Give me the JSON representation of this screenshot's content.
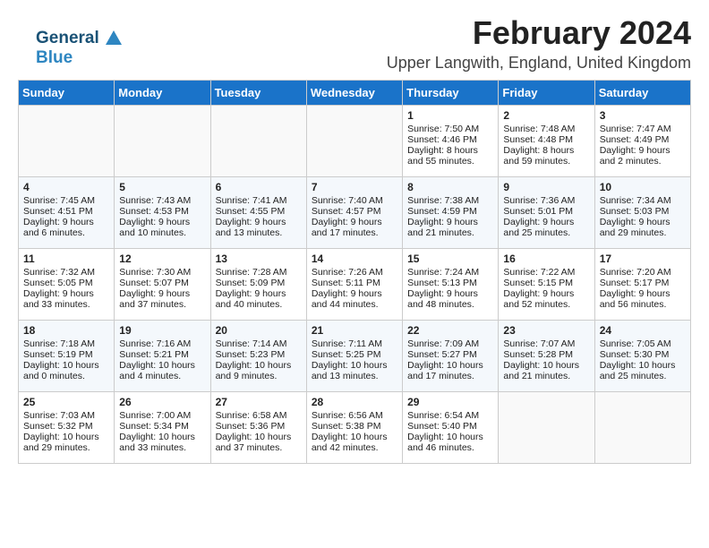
{
  "logo": {
    "line1": "General",
    "line2": "Blue"
  },
  "header": {
    "title": "February 2024",
    "subtitle": "Upper Langwith, England, United Kingdom"
  },
  "days_of_week": [
    "Sunday",
    "Monday",
    "Tuesday",
    "Wednesday",
    "Thursday",
    "Friday",
    "Saturday"
  ],
  "weeks": [
    [
      {
        "day": "",
        "sunrise": "",
        "sunset": "",
        "daylight": ""
      },
      {
        "day": "",
        "sunrise": "",
        "sunset": "",
        "daylight": ""
      },
      {
        "day": "",
        "sunrise": "",
        "sunset": "",
        "daylight": ""
      },
      {
        "day": "",
        "sunrise": "",
        "sunset": "",
        "daylight": ""
      },
      {
        "day": "1",
        "sunrise": "Sunrise: 7:50 AM",
        "sunset": "Sunset: 4:46 PM",
        "daylight": "Daylight: 8 hours and 55 minutes."
      },
      {
        "day": "2",
        "sunrise": "Sunrise: 7:48 AM",
        "sunset": "Sunset: 4:48 PM",
        "daylight": "Daylight: 8 hours and 59 minutes."
      },
      {
        "day": "3",
        "sunrise": "Sunrise: 7:47 AM",
        "sunset": "Sunset: 4:49 PM",
        "daylight": "Daylight: 9 hours and 2 minutes."
      }
    ],
    [
      {
        "day": "4",
        "sunrise": "Sunrise: 7:45 AM",
        "sunset": "Sunset: 4:51 PM",
        "daylight": "Daylight: 9 hours and 6 minutes."
      },
      {
        "day": "5",
        "sunrise": "Sunrise: 7:43 AM",
        "sunset": "Sunset: 4:53 PM",
        "daylight": "Daylight: 9 hours and 10 minutes."
      },
      {
        "day": "6",
        "sunrise": "Sunrise: 7:41 AM",
        "sunset": "Sunset: 4:55 PM",
        "daylight": "Daylight: 9 hours and 13 minutes."
      },
      {
        "day": "7",
        "sunrise": "Sunrise: 7:40 AM",
        "sunset": "Sunset: 4:57 PM",
        "daylight": "Daylight: 9 hours and 17 minutes."
      },
      {
        "day": "8",
        "sunrise": "Sunrise: 7:38 AM",
        "sunset": "Sunset: 4:59 PM",
        "daylight": "Daylight: 9 hours and 21 minutes."
      },
      {
        "day": "9",
        "sunrise": "Sunrise: 7:36 AM",
        "sunset": "Sunset: 5:01 PM",
        "daylight": "Daylight: 9 hours and 25 minutes."
      },
      {
        "day": "10",
        "sunrise": "Sunrise: 7:34 AM",
        "sunset": "Sunset: 5:03 PM",
        "daylight": "Daylight: 9 hours and 29 minutes."
      }
    ],
    [
      {
        "day": "11",
        "sunrise": "Sunrise: 7:32 AM",
        "sunset": "Sunset: 5:05 PM",
        "daylight": "Daylight: 9 hours and 33 minutes."
      },
      {
        "day": "12",
        "sunrise": "Sunrise: 7:30 AM",
        "sunset": "Sunset: 5:07 PM",
        "daylight": "Daylight: 9 hours and 37 minutes."
      },
      {
        "day": "13",
        "sunrise": "Sunrise: 7:28 AM",
        "sunset": "Sunset: 5:09 PM",
        "daylight": "Daylight: 9 hours and 40 minutes."
      },
      {
        "day": "14",
        "sunrise": "Sunrise: 7:26 AM",
        "sunset": "Sunset: 5:11 PM",
        "daylight": "Daylight: 9 hours and 44 minutes."
      },
      {
        "day": "15",
        "sunrise": "Sunrise: 7:24 AM",
        "sunset": "Sunset: 5:13 PM",
        "daylight": "Daylight: 9 hours and 48 minutes."
      },
      {
        "day": "16",
        "sunrise": "Sunrise: 7:22 AM",
        "sunset": "Sunset: 5:15 PM",
        "daylight": "Daylight: 9 hours and 52 minutes."
      },
      {
        "day": "17",
        "sunrise": "Sunrise: 7:20 AM",
        "sunset": "Sunset: 5:17 PM",
        "daylight": "Daylight: 9 hours and 56 minutes."
      }
    ],
    [
      {
        "day": "18",
        "sunrise": "Sunrise: 7:18 AM",
        "sunset": "Sunset: 5:19 PM",
        "daylight": "Daylight: 10 hours and 0 minutes."
      },
      {
        "day": "19",
        "sunrise": "Sunrise: 7:16 AM",
        "sunset": "Sunset: 5:21 PM",
        "daylight": "Daylight: 10 hours and 4 minutes."
      },
      {
        "day": "20",
        "sunrise": "Sunrise: 7:14 AM",
        "sunset": "Sunset: 5:23 PM",
        "daylight": "Daylight: 10 hours and 9 minutes."
      },
      {
        "day": "21",
        "sunrise": "Sunrise: 7:11 AM",
        "sunset": "Sunset: 5:25 PM",
        "daylight": "Daylight: 10 hours and 13 minutes."
      },
      {
        "day": "22",
        "sunrise": "Sunrise: 7:09 AM",
        "sunset": "Sunset: 5:27 PM",
        "daylight": "Daylight: 10 hours and 17 minutes."
      },
      {
        "day": "23",
        "sunrise": "Sunrise: 7:07 AM",
        "sunset": "Sunset: 5:28 PM",
        "daylight": "Daylight: 10 hours and 21 minutes."
      },
      {
        "day": "24",
        "sunrise": "Sunrise: 7:05 AM",
        "sunset": "Sunset: 5:30 PM",
        "daylight": "Daylight: 10 hours and 25 minutes."
      }
    ],
    [
      {
        "day": "25",
        "sunrise": "Sunrise: 7:03 AM",
        "sunset": "Sunset: 5:32 PM",
        "daylight": "Daylight: 10 hours and 29 minutes."
      },
      {
        "day": "26",
        "sunrise": "Sunrise: 7:00 AM",
        "sunset": "Sunset: 5:34 PM",
        "daylight": "Daylight: 10 hours and 33 minutes."
      },
      {
        "day": "27",
        "sunrise": "Sunrise: 6:58 AM",
        "sunset": "Sunset: 5:36 PM",
        "daylight": "Daylight: 10 hours and 37 minutes."
      },
      {
        "day": "28",
        "sunrise": "Sunrise: 6:56 AM",
        "sunset": "Sunset: 5:38 PM",
        "daylight": "Daylight: 10 hours and 42 minutes."
      },
      {
        "day": "29",
        "sunrise": "Sunrise: 6:54 AM",
        "sunset": "Sunset: 5:40 PM",
        "daylight": "Daylight: 10 hours and 46 minutes."
      },
      {
        "day": "",
        "sunrise": "",
        "sunset": "",
        "daylight": ""
      },
      {
        "day": "",
        "sunrise": "",
        "sunset": "",
        "daylight": ""
      }
    ]
  ]
}
